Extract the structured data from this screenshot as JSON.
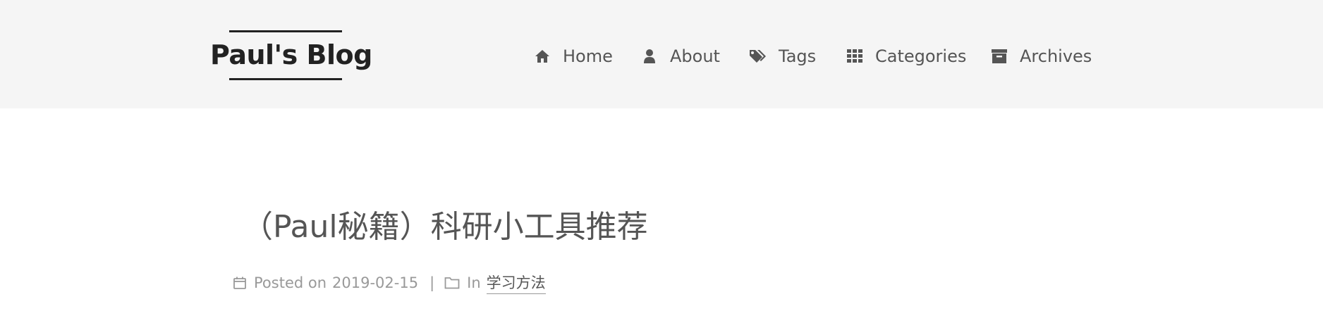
{
  "site": {
    "brand": "Paul's Blog"
  },
  "nav": {
    "items": [
      {
        "label": "Home",
        "icon": "home-icon"
      },
      {
        "label": "About",
        "icon": "user-icon"
      },
      {
        "label": "Tags",
        "icon": "tags-icon"
      },
      {
        "label": "Categories",
        "icon": "th-grid-icon"
      },
      {
        "label": "Archives",
        "icon": "archive-icon"
      }
    ]
  },
  "post": {
    "title": "（Paul秘籍）科研小工具推荐",
    "posted_label": "Posted on",
    "date": "2019-02-15",
    "separator": "|",
    "in_label": "In",
    "category": "学习方法"
  },
  "colors": {
    "header_bg": "#f5f5f5",
    "brand_text": "#222222",
    "nav_text": "#555555",
    "meta_text": "#999999"
  }
}
